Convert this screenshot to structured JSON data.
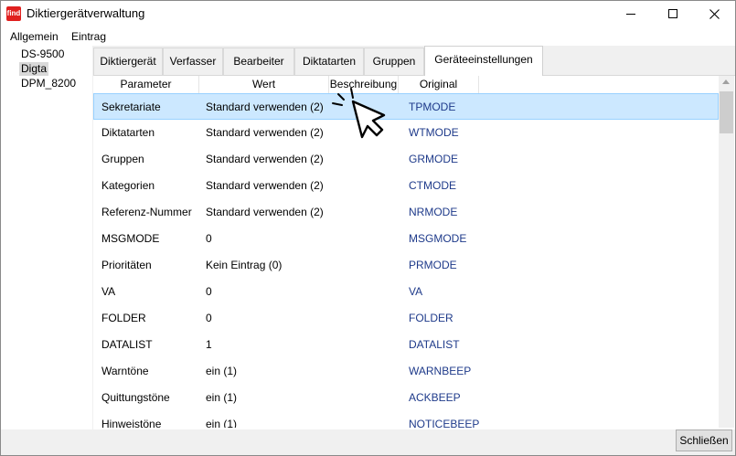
{
  "window": {
    "title": "Diktiergerätverwaltung",
    "app_icon_text": "find"
  },
  "menu": [
    "Allgemein",
    "Eintrag"
  ],
  "devices": [
    {
      "name": "DS-9500",
      "selected": false
    },
    {
      "name": "Digta",
      "selected": true
    },
    {
      "name": "DPM_8200",
      "selected": false
    }
  ],
  "tabs": [
    {
      "label": "Diktiergerät",
      "active": false
    },
    {
      "label": "Verfasser",
      "active": false
    },
    {
      "label": "Bearbeiter",
      "active": false
    },
    {
      "label": "Diktatarten",
      "active": false
    },
    {
      "label": "Gruppen",
      "active": false
    },
    {
      "label": "Geräteeinstellungen",
      "active": true
    }
  ],
  "grid": {
    "columns": [
      "Parameter",
      "Wert",
      "Beschreibung",
      "Original"
    ],
    "rows": [
      {
        "parameter": "Sekretariate",
        "wert": "Standard verwenden (2)",
        "beschreibung": "",
        "original": "TPMODE",
        "selected": true
      },
      {
        "parameter": "Diktatarten",
        "wert": "Standard verwenden (2)",
        "beschreibung": "",
        "original": "WTMODE"
      },
      {
        "parameter": "Gruppen",
        "wert": "Standard verwenden (2)",
        "beschreibung": "",
        "original": "GRMODE"
      },
      {
        "parameter": "Kategorien",
        "wert": "Standard verwenden (2)",
        "beschreibung": "",
        "original": "CTMODE"
      },
      {
        "parameter": "Referenz-Nummer",
        "wert": "Standard verwenden (2)",
        "beschreibung": "",
        "original": "NRMODE"
      },
      {
        "parameter": "MSGMODE",
        "wert": "0",
        "beschreibung": "",
        "original": "MSGMODE"
      },
      {
        "parameter": "Prioritäten",
        "wert": "Kein Eintrag (0)",
        "beschreibung": "",
        "original": "PRMODE"
      },
      {
        "parameter": "VA",
        "wert": "0",
        "beschreibung": "",
        "original": "VA"
      },
      {
        "parameter": "FOLDER",
        "wert": "0",
        "beschreibung": "",
        "original": "FOLDER"
      },
      {
        "parameter": "DATALIST",
        "wert": "1",
        "beschreibung": "",
        "original": "DATALIST"
      },
      {
        "parameter": "Warntöne",
        "wert": "ein (1)",
        "beschreibung": "",
        "original": "WARNBEEP"
      },
      {
        "parameter": "Quittungstöne",
        "wert": "ein (1)",
        "beschreibung": "",
        "original": "ACKBEEP"
      },
      {
        "parameter": "Hinweistöne",
        "wert": "ein (1)",
        "beschreibung": "",
        "original": "NOTICEBEEP"
      }
    ]
  },
  "buttons": {
    "close": "Schließen"
  },
  "colors": {
    "selection": "#cce8ff",
    "original_text": "#1e3a8a",
    "app_icon": "#e0201f"
  }
}
